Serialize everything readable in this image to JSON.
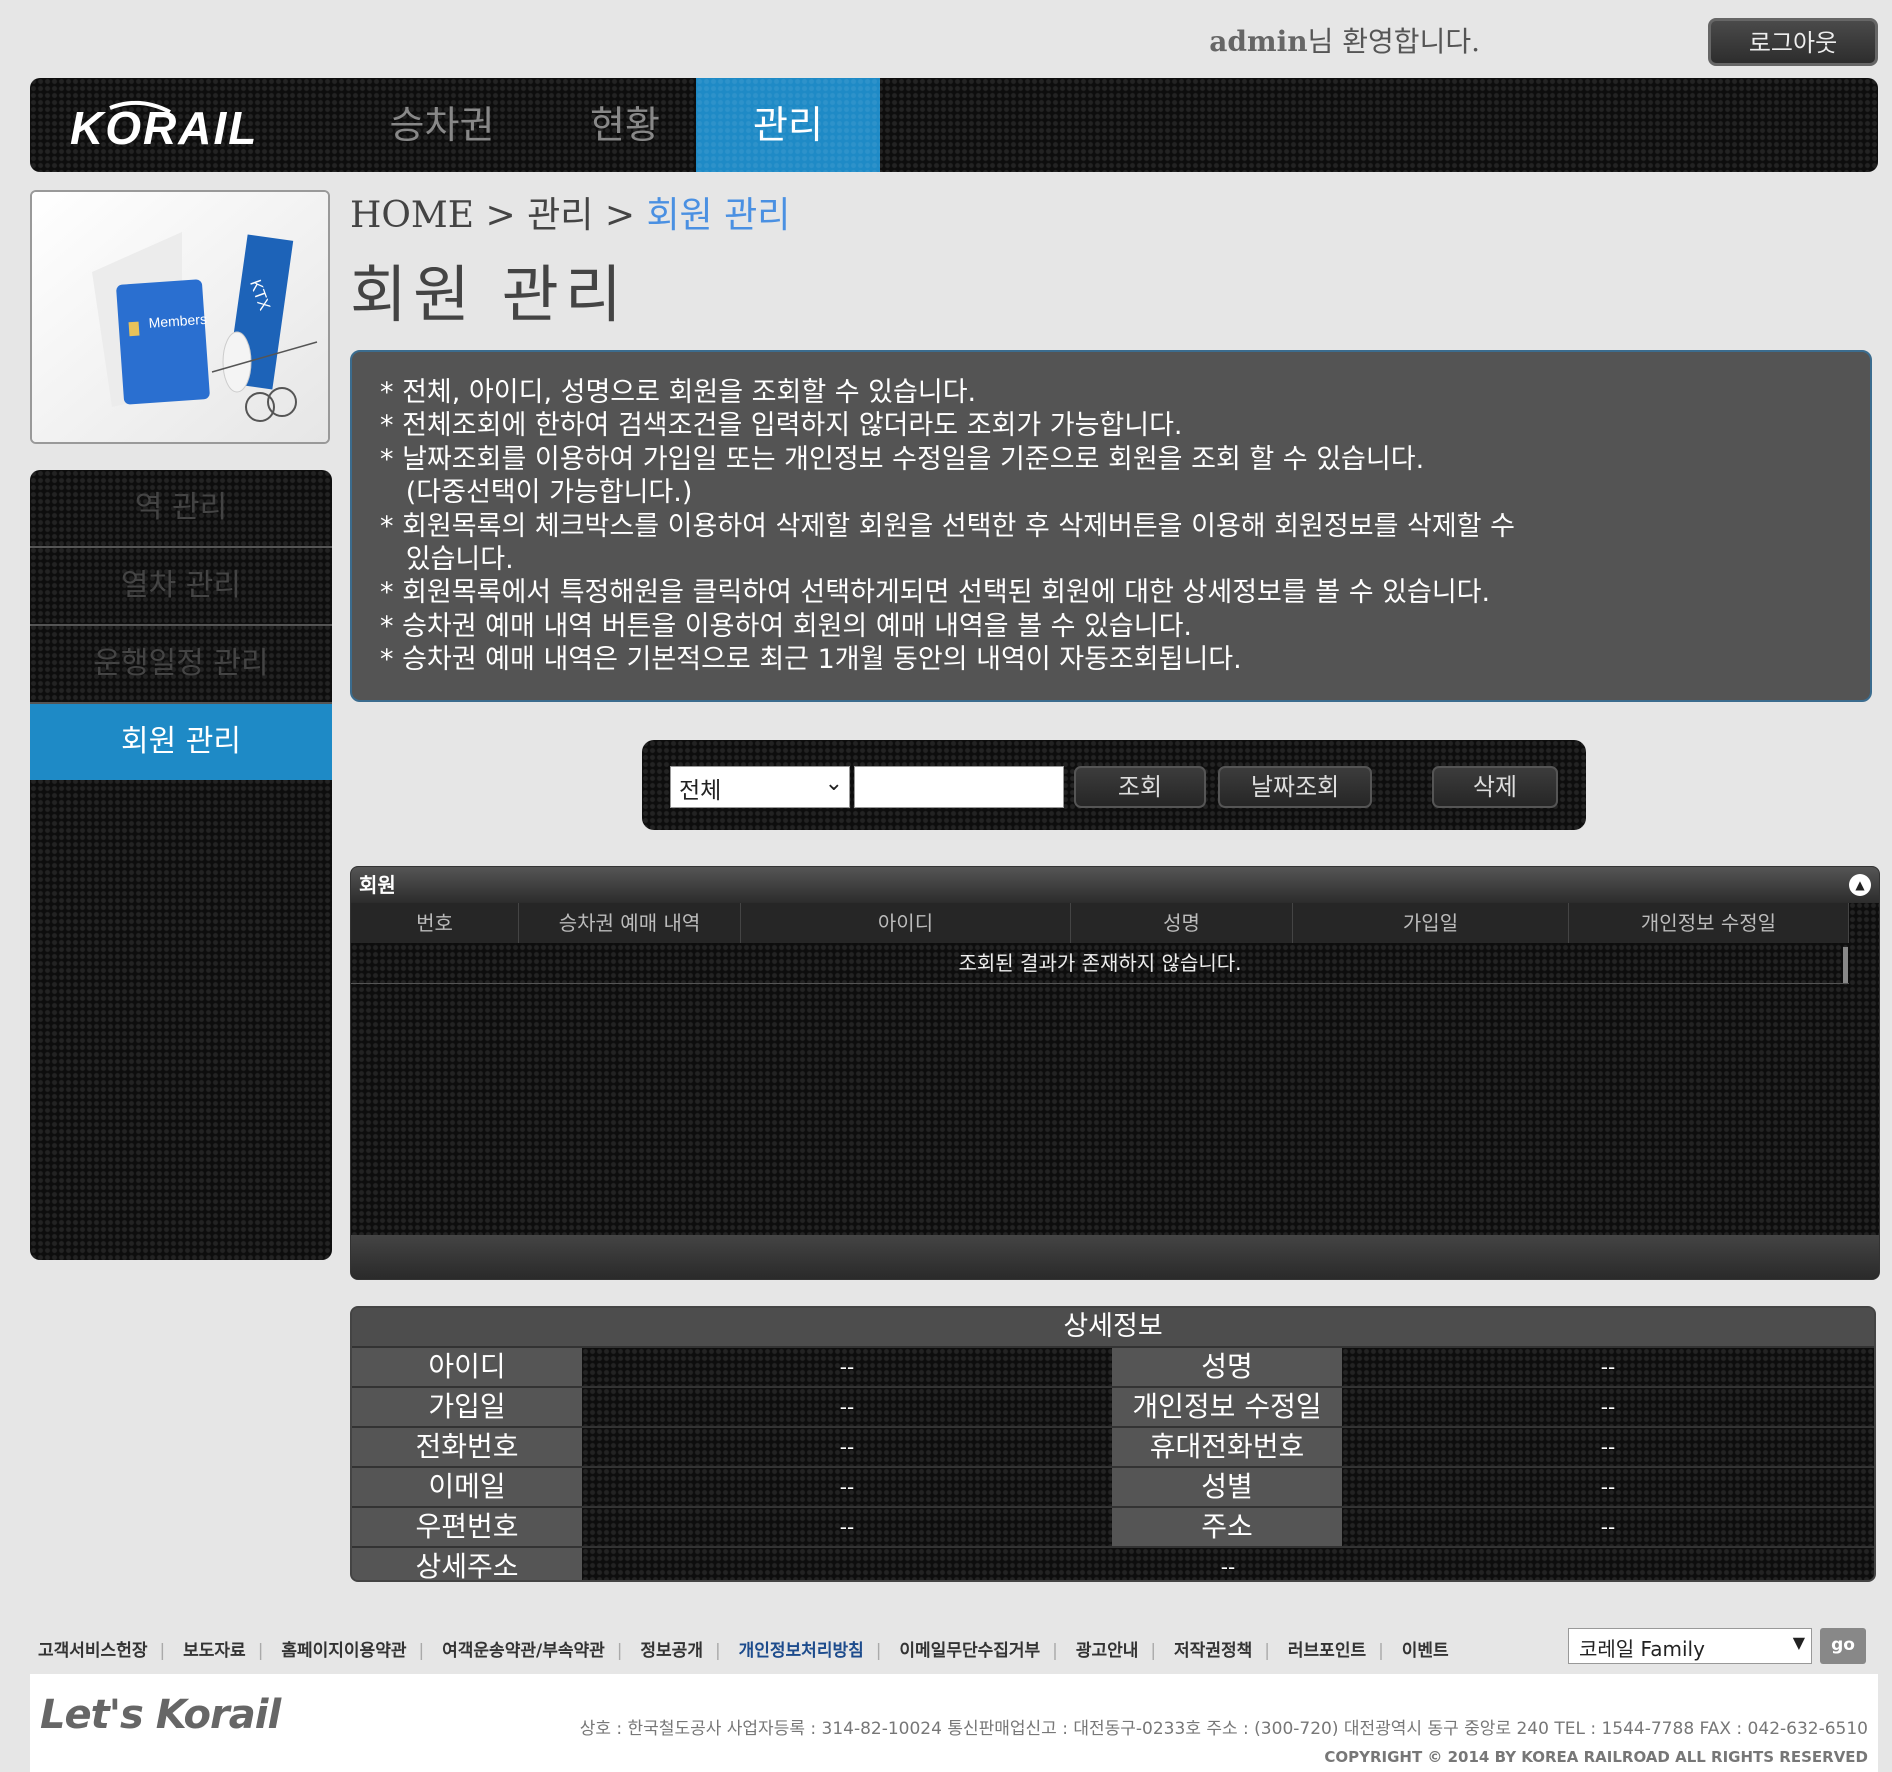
{
  "top": {
    "user": "admin",
    "welcome_suffix": "님 환영합니다.",
    "logout_label": "로그아웃"
  },
  "header": {
    "logo_text": "KORAIL",
    "nav": [
      {
        "label": "승차권",
        "active": false
      },
      {
        "label": "현황",
        "active": false
      },
      {
        "label": "관리",
        "active": true
      }
    ]
  },
  "side_image": {
    "card_text": "Members",
    "book_text": "KTX"
  },
  "sidebar": {
    "items": [
      {
        "label": "역 관리"
      },
      {
        "label": "열차 관리"
      },
      {
        "label": "운행일정 관리"
      },
      {
        "label": "회원 관리",
        "active": true
      }
    ]
  },
  "breadcrumb": {
    "home": "HOME",
    "sep": " > ",
    "section": "관리",
    "current": "회원 관리"
  },
  "page_title": "회원 관리",
  "info": {
    "lines": [
      "* 전체, 아이디, 성명으로 회원을 조회할 수 있습니다.",
      "* 전체조회에 한하여 검색조건을 입력하지 않더라도 조회가 가능합니다.",
      "* 날짜조회를 이용하여 가입일 또는 개인정보 수정일을 기준으로 회원을 조회 할 수 있습니다.",
      "   (다중선택이 가능합니다.)",
      "* 회원목록의 체크박스를 이용하여 삭제할 회원을 선택한 후 삭제버튼을 이용해 회원정보를 삭제할 수",
      "   있습니다.",
      "* 회원목록에서 특정해원을 클릭하여 선택하게되면 선택된 회원에 대한 상세정보를 볼 수 있습니다.",
      "* 승차권 예매 내역 버튼을 이용하여 회원의 예매 내역을 볼 수 있습니다.",
      "* 승차권 예매 내역은 기본적으로 최근 1개월 동안의 내역이 자동조회됩니다."
    ]
  },
  "search": {
    "select_value": "전체",
    "keyword_value": "",
    "search_label": "조회",
    "date_search_label": "날짜조회",
    "delete_label": "삭제"
  },
  "grid": {
    "caption": "회원",
    "columns": [
      "번호",
      "승차권 예매 내역",
      "아이디",
      "성명",
      "가입일",
      "개인정보 수정일"
    ],
    "empty_message": "조회된 결과가 존재하지 않습니다."
  },
  "detail": {
    "caption": "상세정보",
    "rows": [
      {
        "l1": "아이디",
        "v1": "--",
        "l2": "성명",
        "v2": "--"
      },
      {
        "l1": "가입일",
        "v1": "--",
        "l2": "개인정보 수정일",
        "v2": "--"
      },
      {
        "l1": "전화번호",
        "v1": "--",
        "l2": "휴대전화번호",
        "v2": "--"
      },
      {
        "l1": "이메일",
        "v1": "--",
        "l2": "성별",
        "v2": "--"
      },
      {
        "l1": "우편번호",
        "v1": "--",
        "l2": "주소",
        "v2": "--"
      }
    ],
    "last_row": {
      "label": "상세주소",
      "value": "--"
    }
  },
  "footer": {
    "links": [
      "고객서비스헌장",
      "보도자료",
      "홈페이지이용약관",
      "여객운송약관/부속약관",
      "정보공개",
      "개인정보처리방침",
      "이메일무단수집거부",
      "광고안내",
      "저작권정책",
      "러브포인트",
      "이벤트"
    ],
    "family_select": "코레일 Family",
    "go_label": "go",
    "brand": "Let's Korail",
    "address": "상호 : 한국철도공사    사업자등록 : 314-82-10024    통신판매업신고 : 대전동구-0233호    주소 : (300-720) 대전광역시 동구 중앙로 240    TEL : 1544-7788    FAX : 042-632-6510",
    "copyright": "COPYRIGHT © 2014 BY KOREA RAILROAD  ALL RIGHTS RESERVED"
  }
}
